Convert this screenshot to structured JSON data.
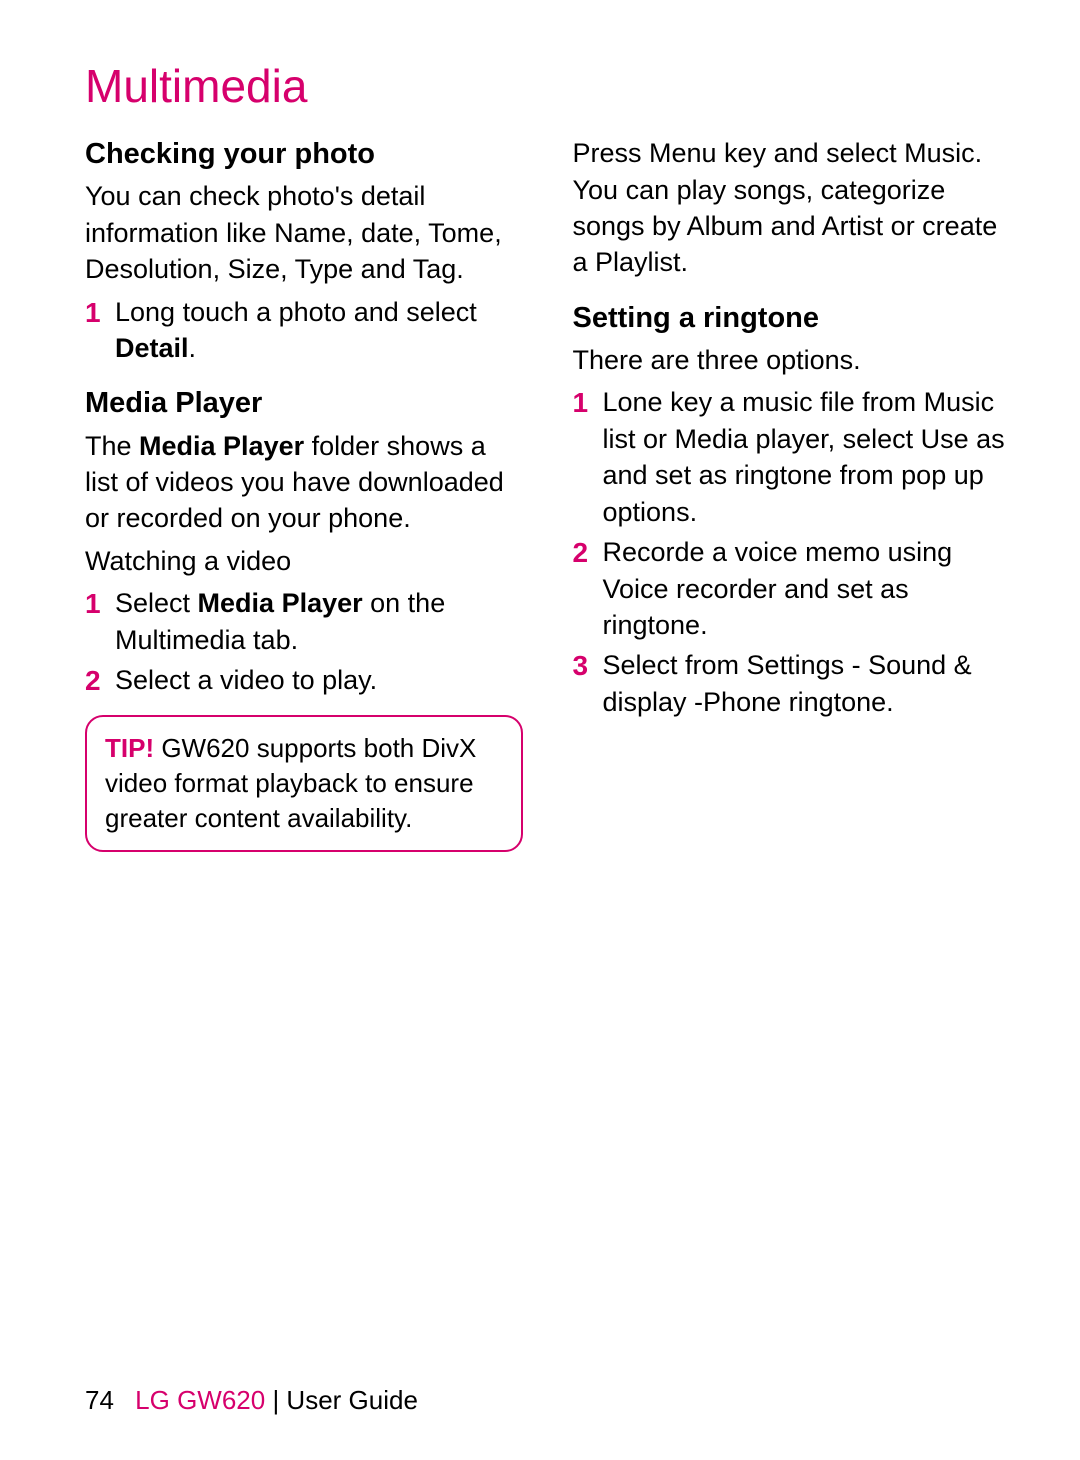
{
  "title": "Multimedia",
  "col1": {
    "s1": {
      "heading": "Checking your photo",
      "p1": "You can check photo's detail information like Name, date, Tome, Desolution, Size, Type and Tag.",
      "l1_num": "1",
      "l1_pre": "Long touch a photo and select ",
      "l1_bold": "Detail",
      "l1_post": "."
    },
    "s2": {
      "heading": "Media Player",
      "p1_pre": "The ",
      "p1_bold": "Media Player",
      "p1_post": " folder shows a list of videos you have downloaded or recorded on your phone.",
      "p2": "Watching a video",
      "l1_num": "1",
      "l1_pre": "Select ",
      "l1_bold": "Media Player",
      "l1_post": " on the Multimedia tab.",
      "l2_num": "2",
      "l2": "Select a video to play."
    },
    "tip": {
      "label": "TIP!",
      "text": " GW620 supports both DivX video format playback to ensure greater content availability."
    }
  },
  "col2": {
    "p1": "Press Menu key and select Music. You can play songs, categorize songs by Album and Artist or create a Playlist.",
    "s1": {
      "heading": "Setting a ringtone",
      "p1": "There are three options.",
      "l1_num": "1",
      "l1": "Lone key a music file from Music list or Media player, select Use as and set as ringtone from pop up options.",
      "l2_num": "2",
      "l2": "Recorde a voice memo using Voice recorder and set as ringtone.",
      "l3_num": "3",
      "l3": "Select from Settings - Sound & display -Phone ringtone."
    }
  },
  "footer": {
    "page": "74",
    "brand": "LG GW620",
    "sep": "  |  ",
    "guide": "User Guide"
  }
}
